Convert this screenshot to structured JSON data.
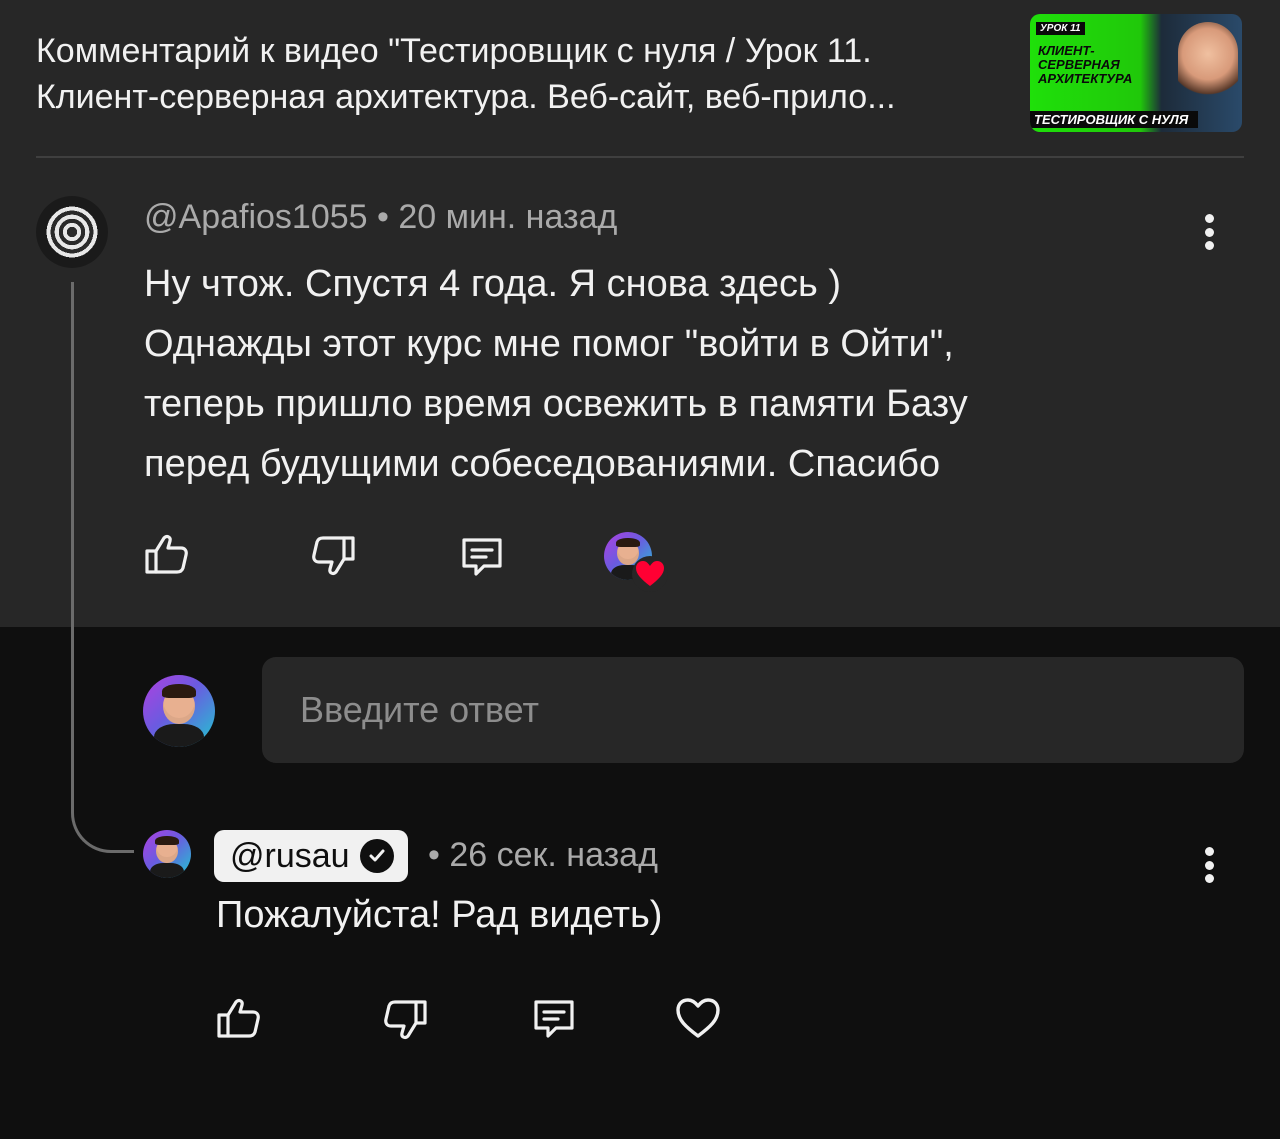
{
  "header": {
    "title_line1": "Комментарий к видео \"Тестировщик с нуля / Урок 11.",
    "title_line2": "Клиент-серверная архитектура. Веб-сайт, веб-прило...",
    "thumbnail": {
      "tag": "УРОК 11",
      "headline": "КЛИЕНТ-СЕРВЕРНАЯ АРХИТЕКТУРА",
      "footer": "ТЕСТИРОВЩИК С НУЛЯ"
    }
  },
  "comment": {
    "author": "@Apafios1055",
    "separator": "•",
    "time": "20 мин. назад",
    "lines": [
      "Ну чтож. Спустя 4 года. Я снова здесь )",
      "Однажды этот курс мне помог \"войти в Ойти\",",
      "теперь пришло время освежить в памяти Базу",
      "перед будущими собеседованиями. Спасибо"
    ],
    "icons": [
      "like-icon",
      "dislike-icon",
      "reply-icon",
      "creator-heart-icon",
      "more-vert-icon"
    ]
  },
  "reply_box": {
    "placeholder": "Введите ответ"
  },
  "reply": {
    "author": "@rusau",
    "time": "• 26 сек. назад",
    "text": "Пожалуйста! Рад видеть)",
    "icons": [
      "like-icon",
      "dislike-icon",
      "reply-icon",
      "heart-icon",
      "more-vert-icon"
    ]
  },
  "colors": {
    "panel": "#272727",
    "background": "#0f0f0f",
    "text": "#f1f1f1",
    "muted": "#aaaaaa",
    "heart": "#ff0033"
  }
}
